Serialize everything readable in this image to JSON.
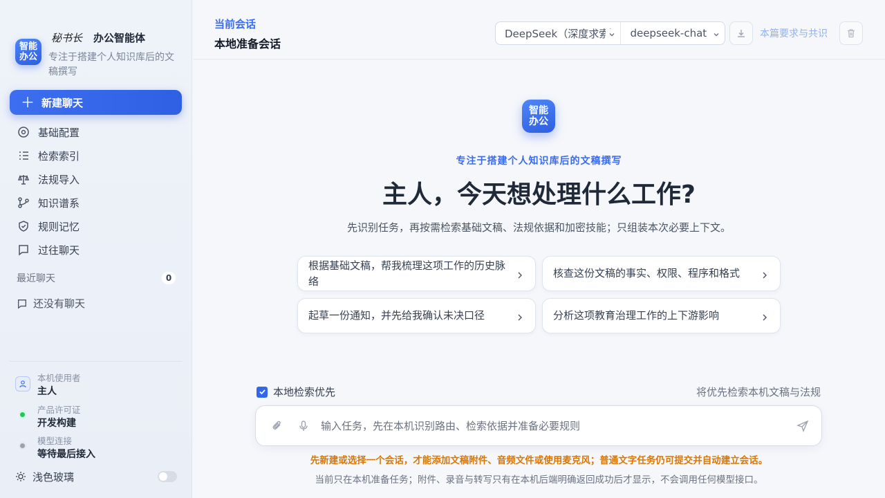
{
  "brand": {
    "logo_line1": "智能",
    "logo_line2": "办公",
    "signature": "秘书长",
    "name": "办公智能体",
    "description": "专注于搭建个人知识库后的文稿撰写"
  },
  "sidebar": {
    "new_chat_label": "新建聊天",
    "items": [
      {
        "label": "基础配置",
        "icon": "gear-icon"
      },
      {
        "label": "检索索引",
        "icon": "list-icon"
      },
      {
        "label": "法规导入",
        "icon": "scale-icon"
      },
      {
        "label": "知识谱系",
        "icon": "graph-icon"
      },
      {
        "label": "规则记忆",
        "icon": "shield-icon"
      },
      {
        "label": "过往聊天",
        "icon": "chat-icon"
      }
    ],
    "recent_title": "最近聊天",
    "recent_count": "0",
    "empty_recent": "还没有聊天",
    "user_label": "本机使用者",
    "user_value": "主人",
    "license_label": "产品许可证",
    "license_value": "开发构建",
    "model_label": "模型连接",
    "model_value": "等待最后接入",
    "theme_label": "浅色玻璃"
  },
  "header": {
    "subtitle": "当前会话",
    "title": "本地准备会话",
    "provider": "DeepSeek（深度求索）",
    "model": "deepseek-chat",
    "link": "本篇要求与共识"
  },
  "hero": {
    "logo_line1": "智能",
    "logo_line2": "办公",
    "tagline": "专注于搭建个人知识库后的文稿撰写",
    "headline": "主人，今天想处理什么工作?",
    "subline": "先识别任务，再按需检索基础文稿、法规依据和加密技能；只组装本次必要上下文。"
  },
  "prompts": [
    "根据基础文稿，帮我梳理这项工作的历史脉络",
    "核查这份文稿的事实、权限、程序和格式",
    "起草一份通知，并先给我确认未决口径",
    "分析这项教育治理工作的上下游影响"
  ],
  "composer": {
    "local_first_label": "本地检索优先",
    "local_first_checked": true,
    "local_first_note": "将优先检索本机文稿与法规",
    "placeholder": "输入任务，先在本机识别路由、检索依据并准备必要规则",
    "warning": "先新建或选择一个会话，才能添加文稿附件、音频文件或使用麦克风；普通文字任务仍可提交并自动建立会话。",
    "note": "当前只在本机准备任务；附件、录音与转写只有在本机后端明确返回成功后才显示，不会调用任何模型接口。"
  },
  "colors": {
    "accent": "#3268e8",
    "warning": "#d97706",
    "status_ok": "#22c55e",
    "status_pending": "#9ca3af"
  }
}
